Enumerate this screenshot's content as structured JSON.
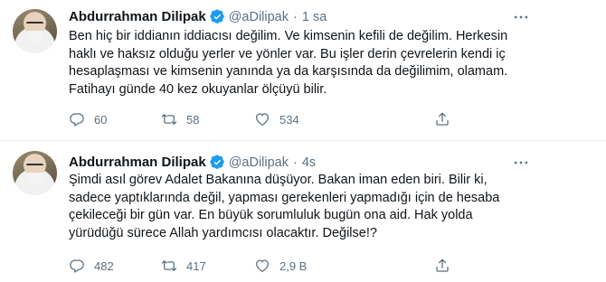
{
  "tweets": [
    {
      "name": "Abdurrahman Dilipak",
      "handle": "@aDilipak",
      "separator": "·",
      "time": "1 sa",
      "text": "Ben hiç bir iddianın iddiacısı değilim. Ve kimsenin kefili de değilim. Herkesin\nhaklı ve haksız olduğu yerler ve yönler var. Bu işler derin çevrelerin kendi iç\nhesaplaşması ve kimsenin yanında ya da karşısında da değilimim, olamam.\nFatihayı günde 40 kez okuyanlar ölçüyü bilir.",
      "replies": "60",
      "retweets": "58",
      "likes": "534"
    },
    {
      "name": "Abdurrahman Dilipak",
      "handle": "@aDilipak",
      "separator": "·",
      "time": "4s",
      "text": "Şimdi asıl görev Adalet Bakanına düşüyor. Bakan iman eden biri. Bilir ki,\nsadece yaptıklarında değil, yapması gerekenleri yapmadığı için de hesaba\nçekileceği bir gün var. En büyük sorumluluk bugün ona aid. Hak yolda\nyürüdüğü sürece Allah yardımcısı olacaktır. Değilse!?",
      "replies": "482",
      "retweets": "417",
      "likes": "2,9 B"
    }
  ],
  "icons": {
    "verified": "verified-badge-icon",
    "more": "more-dots-icon",
    "reply": "reply-icon",
    "retweet": "retweet-icon",
    "like": "heart-icon",
    "share": "share-icon"
  },
  "colors": {
    "text": "#0f1419",
    "secondary": "#5b7083",
    "verified": "#1d9bf0",
    "divider": "#e6ecf0"
  }
}
